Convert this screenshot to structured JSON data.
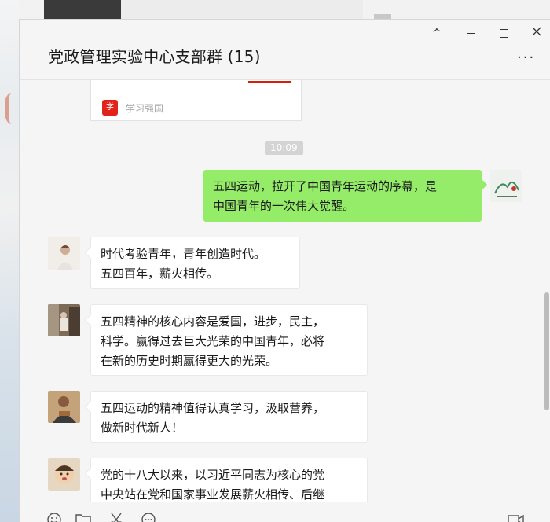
{
  "chat": {
    "title": "党政管理实验中心支部群 (15)"
  },
  "window_controls": {
    "pin": "ᅎ",
    "more": "···"
  },
  "share_card": {
    "source": "学习强国",
    "icon_glyph": "学"
  },
  "timestamp": "10:09",
  "messages": [
    {
      "side": "out",
      "text": "五四运动，拉开了中国青年运动的序幕，是\n中国青年的一次伟大觉醒。"
    },
    {
      "side": "in",
      "text": "时代考验青年，青年创造时代。\n五四百年，薪火相传。"
    },
    {
      "side": "in",
      "text": "五四精神的核心内容是爱国，进步，民主，\n科学。赢得过去巨大光荣的中国青年，必将\n在新的历史时期赢得更大的光荣。"
    },
    {
      "side": "in",
      "text": "五四运动的精神值得认真学习，汲取营养，\n做新时代新人！"
    },
    {
      "side": "in",
      "text": "党的十八大以来，以习近平同志为核心的党\n中央站在党和国家事业发展薪火相传、后继"
    }
  ],
  "colors": {
    "outgoing_bubble": "#95ec69",
    "incoming_bubble": "#ffffff",
    "chat_background": "#f5f5f5",
    "source_brand": "#e2231a"
  },
  "icons": {
    "toolbar": [
      "emoji-icon",
      "folder-icon",
      "scissors-icon",
      "chat-history-icon",
      "video-call-icon"
    ]
  }
}
